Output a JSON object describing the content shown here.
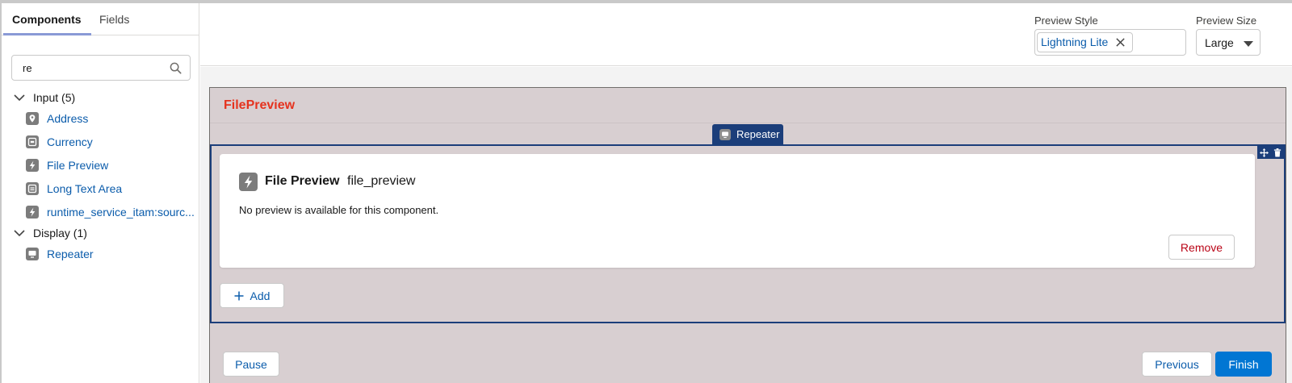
{
  "sidebar": {
    "tabs": [
      {
        "label": "Components",
        "active": true
      },
      {
        "label": "Fields",
        "active": false
      }
    ],
    "search": {
      "value": "re",
      "placeholder": ""
    },
    "groups": [
      {
        "label": "Input (5)",
        "items": [
          {
            "label": "Address",
            "icon": "location-icon"
          },
          {
            "label": "Currency",
            "icon": "currency-icon"
          },
          {
            "label": "File Preview",
            "icon": "lightning-icon"
          },
          {
            "label": "Long Text Area",
            "icon": "textarea-icon"
          },
          {
            "label": "runtime_service_itam:sourc...",
            "icon": "lightning-icon"
          }
        ]
      },
      {
        "label": "Display (1)",
        "items": [
          {
            "label": "Repeater",
            "icon": "repeater-icon"
          }
        ]
      }
    ]
  },
  "header": {
    "preview_style_label": "Preview Style",
    "preview_style_value": "Lightning Lite",
    "preview_size_label": "Preview Size",
    "preview_size_value": "Large"
  },
  "canvas": {
    "screen_title": "FilePreview",
    "repeater_tag": "Repeater",
    "card": {
      "component_name": "File Preview",
      "component_key": "file_preview",
      "message": "No preview is available for this component.",
      "remove_label": "Remove"
    },
    "add_label": "Add",
    "footer": {
      "pause_label": "Pause",
      "previous_label": "Previous",
      "finish_label": "Finish"
    }
  },
  "colors": {
    "title_red": "#e5331f",
    "link_blue": "#0b5cab",
    "brand_blue": "#0176d3",
    "repeater_navy": "#1b3e7a",
    "remove_red": "#ba0517",
    "screen_bg": "#d8cfd1"
  }
}
